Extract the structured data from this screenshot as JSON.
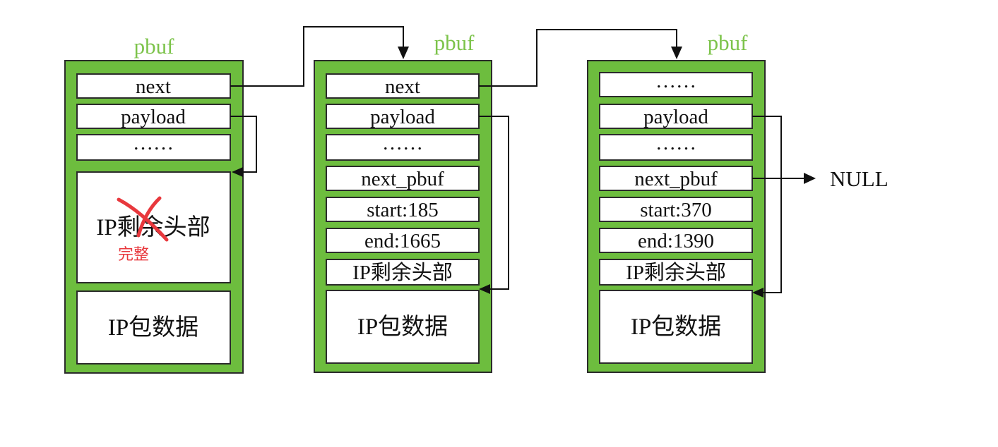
{
  "pbufs": [
    {
      "title": "pbuf",
      "fields": [
        "next",
        "payload",
        "……",
        "IP剩余头部",
        "IP包数据"
      ],
      "annotation": "完整"
    },
    {
      "title": "pbuf",
      "fields": [
        "next",
        "payload",
        "……",
        "next_pbuf",
        "start:185",
        "end:1665",
        "IP剩余头部",
        "IP包数据"
      ]
    },
    {
      "title": "pbuf",
      "fields": [
        "……",
        "payload",
        "……",
        "next_pbuf",
        "start:370",
        "end:1390",
        "IP剩余头部",
        "IP包数据"
      ]
    }
  ],
  "terminal": "NULL",
  "colors": {
    "frame": "#6dbd3e",
    "title": "#7cc34a",
    "annotation": "#e8383d",
    "line": "#111111"
  }
}
